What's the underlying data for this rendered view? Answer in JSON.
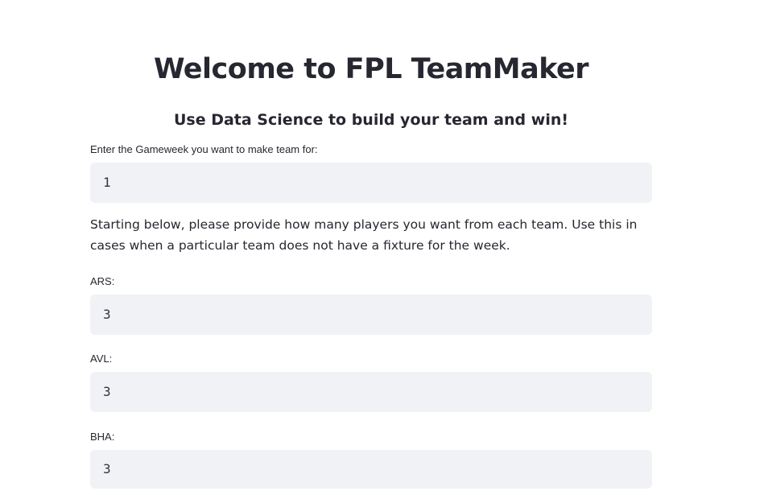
{
  "page": {
    "title": "Welcome to FPL TeamMaker",
    "subtitle": "Use Data Science to build your team and win!"
  },
  "gameweek": {
    "label": "Enter the Gameweek you want to make team for:",
    "value": "1"
  },
  "instructions": "Starting below, please provide how many players you want from each team. Use this in cases when a particular team does not have a fixture for the week.",
  "teams": [
    {
      "label": "ARS:",
      "value": "3"
    },
    {
      "label": "AVL:",
      "value": "3"
    },
    {
      "label": "BHA:",
      "value": "3"
    }
  ],
  "colors": {
    "text": "#262730",
    "input_background": "#f0f2f6",
    "page_background": "#ffffff"
  }
}
